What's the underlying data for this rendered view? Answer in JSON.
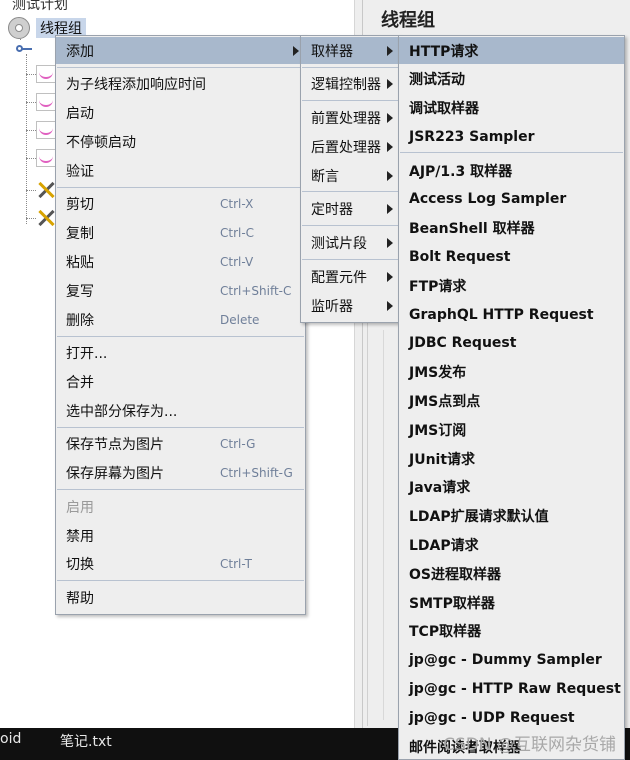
{
  "tree": {
    "top_text": "测试计划",
    "root_label": "线程组"
  },
  "panel": {
    "title": "线程组"
  },
  "context_menu": {
    "items": [
      {
        "label": "添加",
        "shortcut": "",
        "submenu": true,
        "selected": true,
        "disabled": false
      },
      {
        "label": "为子线程添加响应时间",
        "shortcut": "",
        "submenu": false,
        "selected": false,
        "disabled": false
      },
      {
        "label": "启动",
        "shortcut": "",
        "submenu": false,
        "selected": false,
        "disabled": false
      },
      {
        "label": "不停顿启动",
        "shortcut": "",
        "submenu": false,
        "selected": false,
        "disabled": false
      },
      {
        "label": "验证",
        "shortcut": "",
        "submenu": false,
        "selected": false,
        "disabled": false
      },
      {
        "label": "剪切",
        "shortcut": "Ctrl-X",
        "submenu": false,
        "selected": false,
        "disabled": false
      },
      {
        "label": "复制",
        "shortcut": "Ctrl-C",
        "submenu": false,
        "selected": false,
        "disabled": false
      },
      {
        "label": "粘贴",
        "shortcut": "Ctrl-V",
        "submenu": false,
        "selected": false,
        "disabled": false
      },
      {
        "label": "复写",
        "shortcut": "Ctrl+Shift-C",
        "submenu": false,
        "selected": false,
        "disabled": false
      },
      {
        "label": "删除",
        "shortcut": "Delete",
        "submenu": false,
        "selected": false,
        "disabled": false
      },
      {
        "label": "打开...",
        "shortcut": "",
        "submenu": false,
        "selected": false,
        "disabled": false
      },
      {
        "label": "合并",
        "shortcut": "",
        "submenu": false,
        "selected": false,
        "disabled": false
      },
      {
        "label": "选中部分保存为...",
        "shortcut": "",
        "submenu": false,
        "selected": false,
        "disabled": false
      },
      {
        "label": "保存节点为图片",
        "shortcut": "Ctrl-G",
        "submenu": false,
        "selected": false,
        "disabled": false
      },
      {
        "label": "保存屏幕为图片",
        "shortcut": "Ctrl+Shift-G",
        "submenu": false,
        "selected": false,
        "disabled": false
      },
      {
        "label": "启用",
        "shortcut": "",
        "submenu": false,
        "selected": false,
        "disabled": true
      },
      {
        "label": "禁用",
        "shortcut": "",
        "submenu": false,
        "selected": false,
        "disabled": false
      },
      {
        "label": "切换",
        "shortcut": "Ctrl-T",
        "submenu": false,
        "selected": false,
        "disabled": false
      },
      {
        "label": "帮助",
        "shortcut": "",
        "submenu": false,
        "selected": false,
        "disabled": false
      }
    ]
  },
  "add_submenu": {
    "items": [
      {
        "label": "取样器",
        "selected": true
      },
      {
        "label": "逻辑控制器",
        "selected": false
      },
      {
        "label": "前置处理器",
        "selected": false
      },
      {
        "label": "后置处理器",
        "selected": false
      },
      {
        "label": "断言",
        "selected": false
      },
      {
        "label": "定时器",
        "selected": false
      },
      {
        "label": "测试片段",
        "selected": false
      },
      {
        "label": "配置元件",
        "selected": false
      },
      {
        "label": "监听器",
        "selected": false
      }
    ]
  },
  "sampler_submenu": {
    "items": [
      {
        "label": "HTTP请求",
        "selected": true
      },
      {
        "label": "测试活动",
        "selected": false
      },
      {
        "label": "调试取样器",
        "selected": false
      },
      {
        "label": "JSR223 Sampler",
        "selected": false
      },
      {
        "label": "AJP/1.3 取样器",
        "selected": false
      },
      {
        "label": "Access Log Sampler",
        "selected": false
      },
      {
        "label": "BeanShell 取样器",
        "selected": false
      },
      {
        "label": "Bolt Request",
        "selected": false
      },
      {
        "label": "FTP请求",
        "selected": false
      },
      {
        "label": "GraphQL HTTP Request",
        "selected": false
      },
      {
        "label": "JDBC Request",
        "selected": false
      },
      {
        "label": "JMS发布",
        "selected": false
      },
      {
        "label": "JMS点到点",
        "selected": false
      },
      {
        "label": "JMS订阅",
        "selected": false
      },
      {
        "label": "JUnit请求",
        "selected": false
      },
      {
        "label": "Java请求",
        "selected": false
      },
      {
        "label": "LDAP扩展请求默认值",
        "selected": false
      },
      {
        "label": "LDAP请求",
        "selected": false
      },
      {
        "label": "OS进程取样器",
        "selected": false
      },
      {
        "label": "SMTP取样器",
        "selected": false
      },
      {
        "label": "TCP取样器",
        "selected": false
      },
      {
        "label": "jp@gc - Dummy Sampler",
        "selected": false
      },
      {
        "label": "jp@gc - HTTP Raw Request",
        "selected": false
      },
      {
        "label": "jp@gc - UDP Request",
        "selected": false
      },
      {
        "label": "邮件阅读者取样器",
        "selected": false
      }
    ]
  },
  "taskbar": {
    "items": [
      "oid",
      "笔记.txt"
    ]
  },
  "watermark": "CSDN @互联网杂货铺"
}
